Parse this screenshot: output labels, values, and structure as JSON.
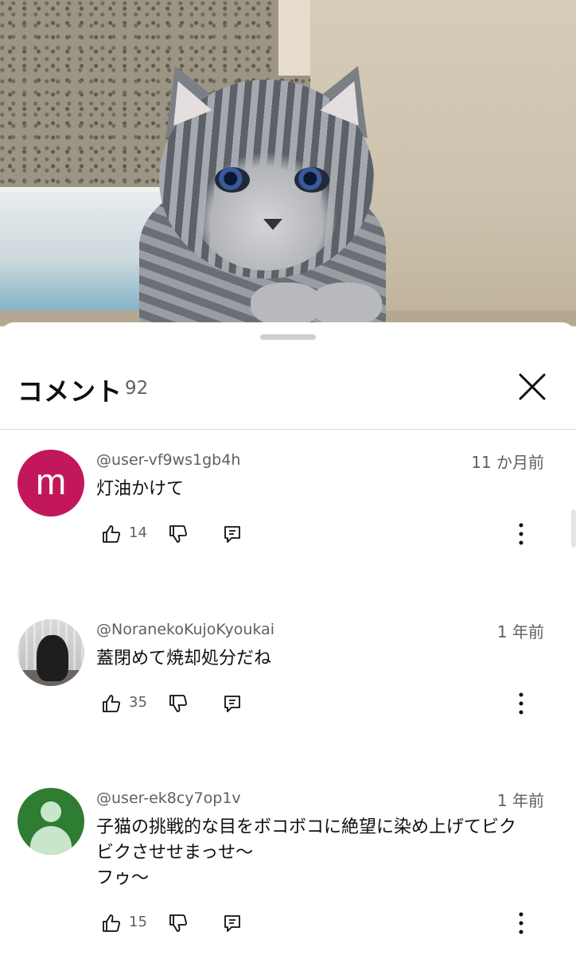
{
  "header": {
    "title": "コメント",
    "count": "92"
  },
  "comments": [
    {
      "author": "@user-vf9ws1gb4h",
      "time": "11 か月前",
      "avatar_letter": "m",
      "avatar_color": "#c2185b",
      "text_lines": [
        "灯油かけて"
      ],
      "likes": "14"
    },
    {
      "author": "@NoranekoKujoKyoukai",
      "time": "1 年前",
      "text_lines": [
        "蓋閉めて焼却処分だね"
      ],
      "likes": "35"
    },
    {
      "author": "@user-ek8cy7op1v",
      "time": "1 年前",
      "avatar_color": "#2e7d32",
      "text_lines": [
        "子猫の挑戦的な目をボコボコに絶望に染め上げてビク",
        "ビクさせせまっせ〜",
        "フゥ〜"
      ],
      "likes": "15"
    }
  ],
  "icons": {
    "close": "close-icon",
    "like": "thumb-up-icon",
    "dislike": "thumb-down-icon",
    "reply": "reply-icon",
    "more": "more-vertical-icon"
  }
}
